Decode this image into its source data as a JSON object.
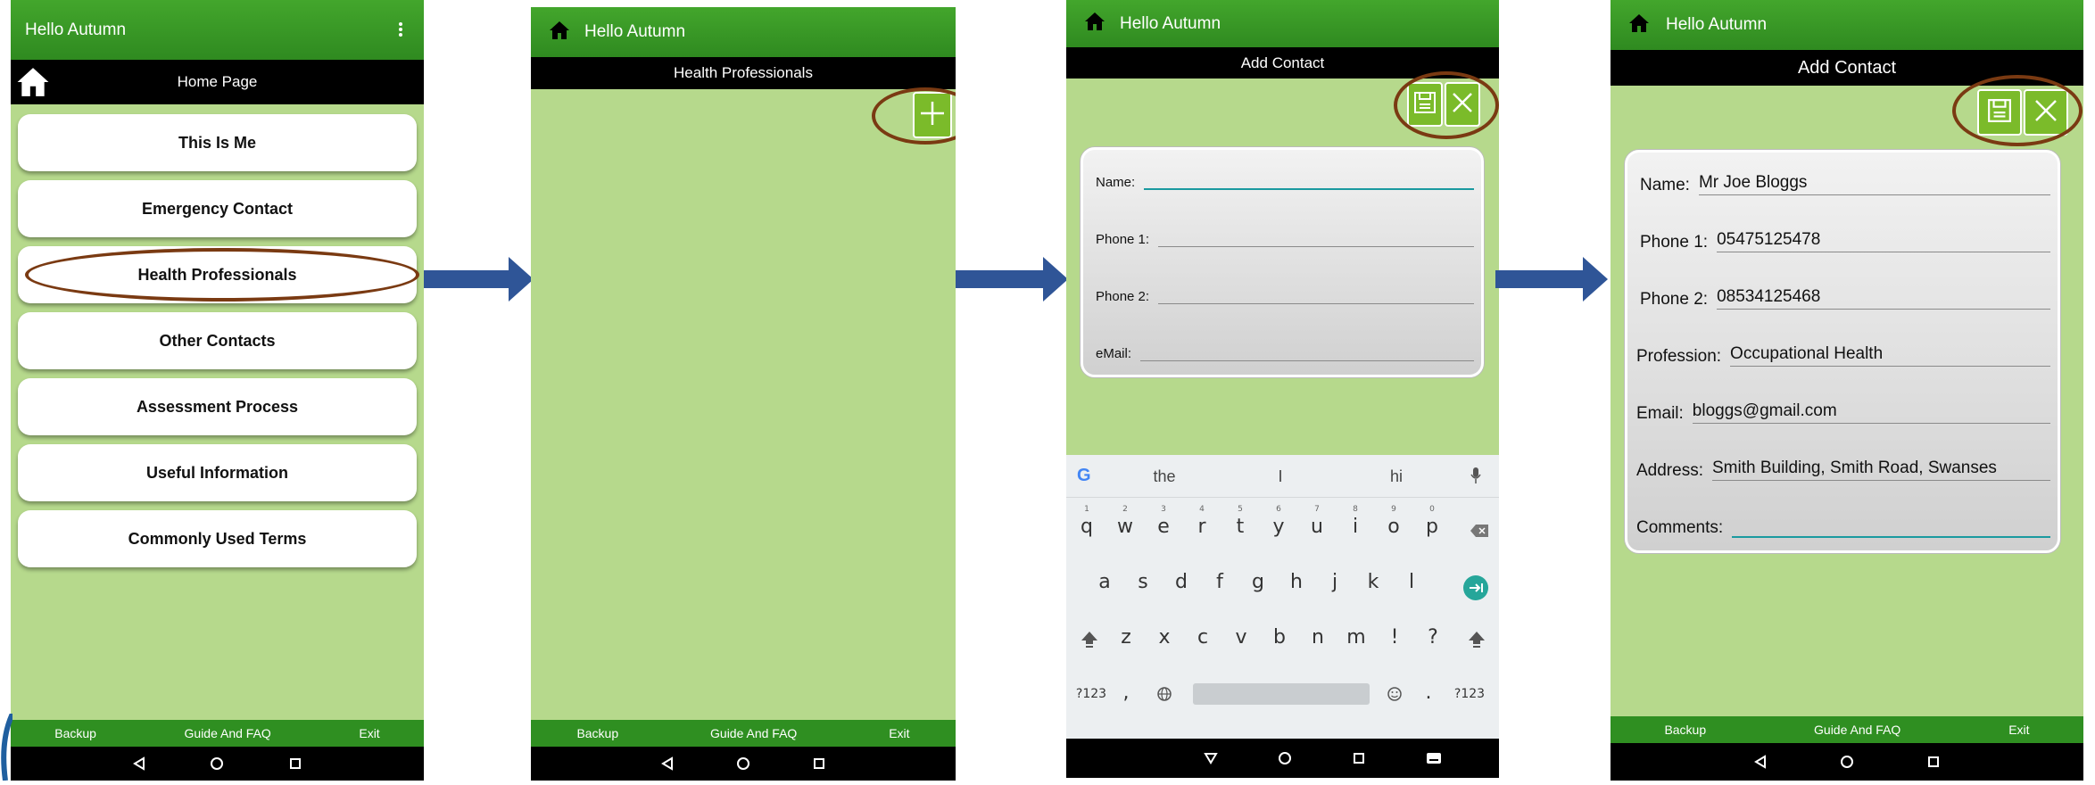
{
  "colors": {
    "app_green": "#3a9c27",
    "background_green": "#b6d98c",
    "button_green": "#7bbb2a",
    "highlight_oval": "#7a3a12",
    "arrow_blue": "#2f5597",
    "input_focus": "#1a9aa0"
  },
  "screen1": {
    "app_title": "Hello Autumn",
    "overflow_icon": "more-vert-icon",
    "page_title": "Home Page",
    "home_icon": "home-icon",
    "menu": [
      {
        "label": "This Is Me"
      },
      {
        "label": "Emergency Contact"
      },
      {
        "label": "Health Professionals",
        "highlighted": true
      },
      {
        "label": "Other Contacts"
      },
      {
        "label": "Assessment Process"
      },
      {
        "label": "Useful Information"
      },
      {
        "label": "Commonly Used Terms"
      }
    ],
    "bottom": {
      "backup": "Backup",
      "guide": "Guide And FAQ",
      "exit": "Exit"
    }
  },
  "screen2": {
    "app_title": "Hello Autumn",
    "page_title": "Health Professionals",
    "add_icon": "plus-icon",
    "bottom": {
      "backup": "Backup",
      "guide": "Guide And FAQ",
      "exit": "Exit"
    }
  },
  "screen3": {
    "app_title": "Hello Autumn",
    "page_title": "Add Contact",
    "fields": [
      {
        "label": "Name:",
        "value": ""
      },
      {
        "label": "Phone 1:",
        "value": ""
      },
      {
        "label": "Phone 2:",
        "value": ""
      },
      {
        "label": "eMail:",
        "value": ""
      }
    ],
    "keyboard": {
      "suggestions": [
        "the",
        "I",
        "hi"
      ],
      "row1": [
        "q",
        "w",
        "e",
        "r",
        "t",
        "y",
        "u",
        "i",
        "o",
        "p"
      ],
      "row1_digits": [
        "1",
        "2",
        "3",
        "4",
        "5",
        "6",
        "7",
        "8",
        "9",
        "0"
      ],
      "row2": [
        "a",
        "s",
        "d",
        "f",
        "g",
        "h",
        "j",
        "k",
        "l"
      ],
      "row3": [
        "z",
        "x",
        "c",
        "v",
        "b",
        "n",
        "m",
        "!",
        "?"
      ],
      "row4_left": "?123",
      "row4_comma": ",",
      "row4_period": ".",
      "row4_right": "?123"
    }
  },
  "screen4": {
    "app_title": "Hello Autumn",
    "page_title": "Add Contact",
    "fields": [
      {
        "label": "Name:",
        "value": "Mr Joe Bloggs"
      },
      {
        "label": "Phone 1:",
        "value": "05475125478"
      },
      {
        "label": "Phone 2:",
        "value": "08534125468"
      },
      {
        "label": "Profession:",
        "value": "Occupational Health"
      },
      {
        "label": "Email:",
        "value": "bloggs@gmail.com"
      },
      {
        "label": "Address:",
        "value": "Smith Building, Smith Road, Swanses"
      },
      {
        "label": "Comments:",
        "value": ""
      }
    ],
    "bottom": {
      "backup": "Backup",
      "guide": "Guide And FAQ",
      "exit": "Exit"
    }
  }
}
